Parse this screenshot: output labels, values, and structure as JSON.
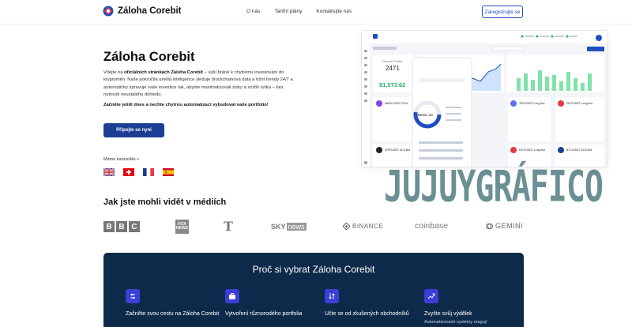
{
  "nav": {
    "brand": "Záloha Corebit",
    "links": [
      "O nás",
      "Tarifní plány",
      "Kontaktujte nás"
    ],
    "register_label": "Zaregistrujte se"
  },
  "hero": {
    "title": "Záloha Corebit",
    "desc_1": "Vítejte na ",
    "desc_bold": "oficiálních stránkách Záloha Corebit",
    "desc_2": " – vaší bráně k chytrému investování do kryptoměn. Naše pokročilá umělá inteligence sleduje blockchainová data a tržní trendy 24/7 a automaticky spravuje vaše investice tak, abyste maximalizovali zisky a snížili rizika – bez nutnosti neustálého dohledu.",
    "cta_text": "Začněte ještě dnes a nechte chytrou automatizaci vybudovat vaše portfolio!",
    "join_label": "Připojte se nyní",
    "offices_label": "Máme kanceláře v"
  },
  "dashboard": {
    "card_title": "Overall Profits",
    "card_count": "2471",
    "card_profit": "$1,573.62",
    "donut_value": "$9461.33",
    "bots": [
      "MATIC/USDT DCA",
      "TRX/USDT Long Bot",
      "DOT/USDT Long Bot",
      "XRP/USDT DCA Bot",
      "DOT/USDT Long Bot",
      "BTC/USDT DCA Bot"
    ]
  },
  "media": {
    "title": "Jak jste mohli vidět v médiích",
    "bbc": [
      "B",
      "B",
      "C"
    ],
    "fox": "FOX\nNEWS",
    "nyt": "T",
    "sky_a": "SKY",
    "sky_b": "news",
    "binance": "BINANCE",
    "coinbase": "coinbase",
    "gemini": "GEMINI"
  },
  "why": {
    "title": "Proč si vybrat Záloha Corebit",
    "features": [
      {
        "text": "Začněte svou cestu na Záloha Corebit",
        "sub": ""
      },
      {
        "text": "Vytvoření různorodého portfolia",
        "sub": ""
      },
      {
        "text": "Učte se od zkušených obchodníků",
        "sub": ""
      },
      {
        "text": "Zvyšte svůj výdělek",
        "sub": "Automatizované systémy reagují"
      }
    ]
  },
  "watermark": "JUJUYGRÁFICO",
  "colors": {
    "primary": "#1c3f94",
    "dark": "#0e2a4a",
    "accent": "#3a3fd6",
    "green": "#22b36b"
  }
}
